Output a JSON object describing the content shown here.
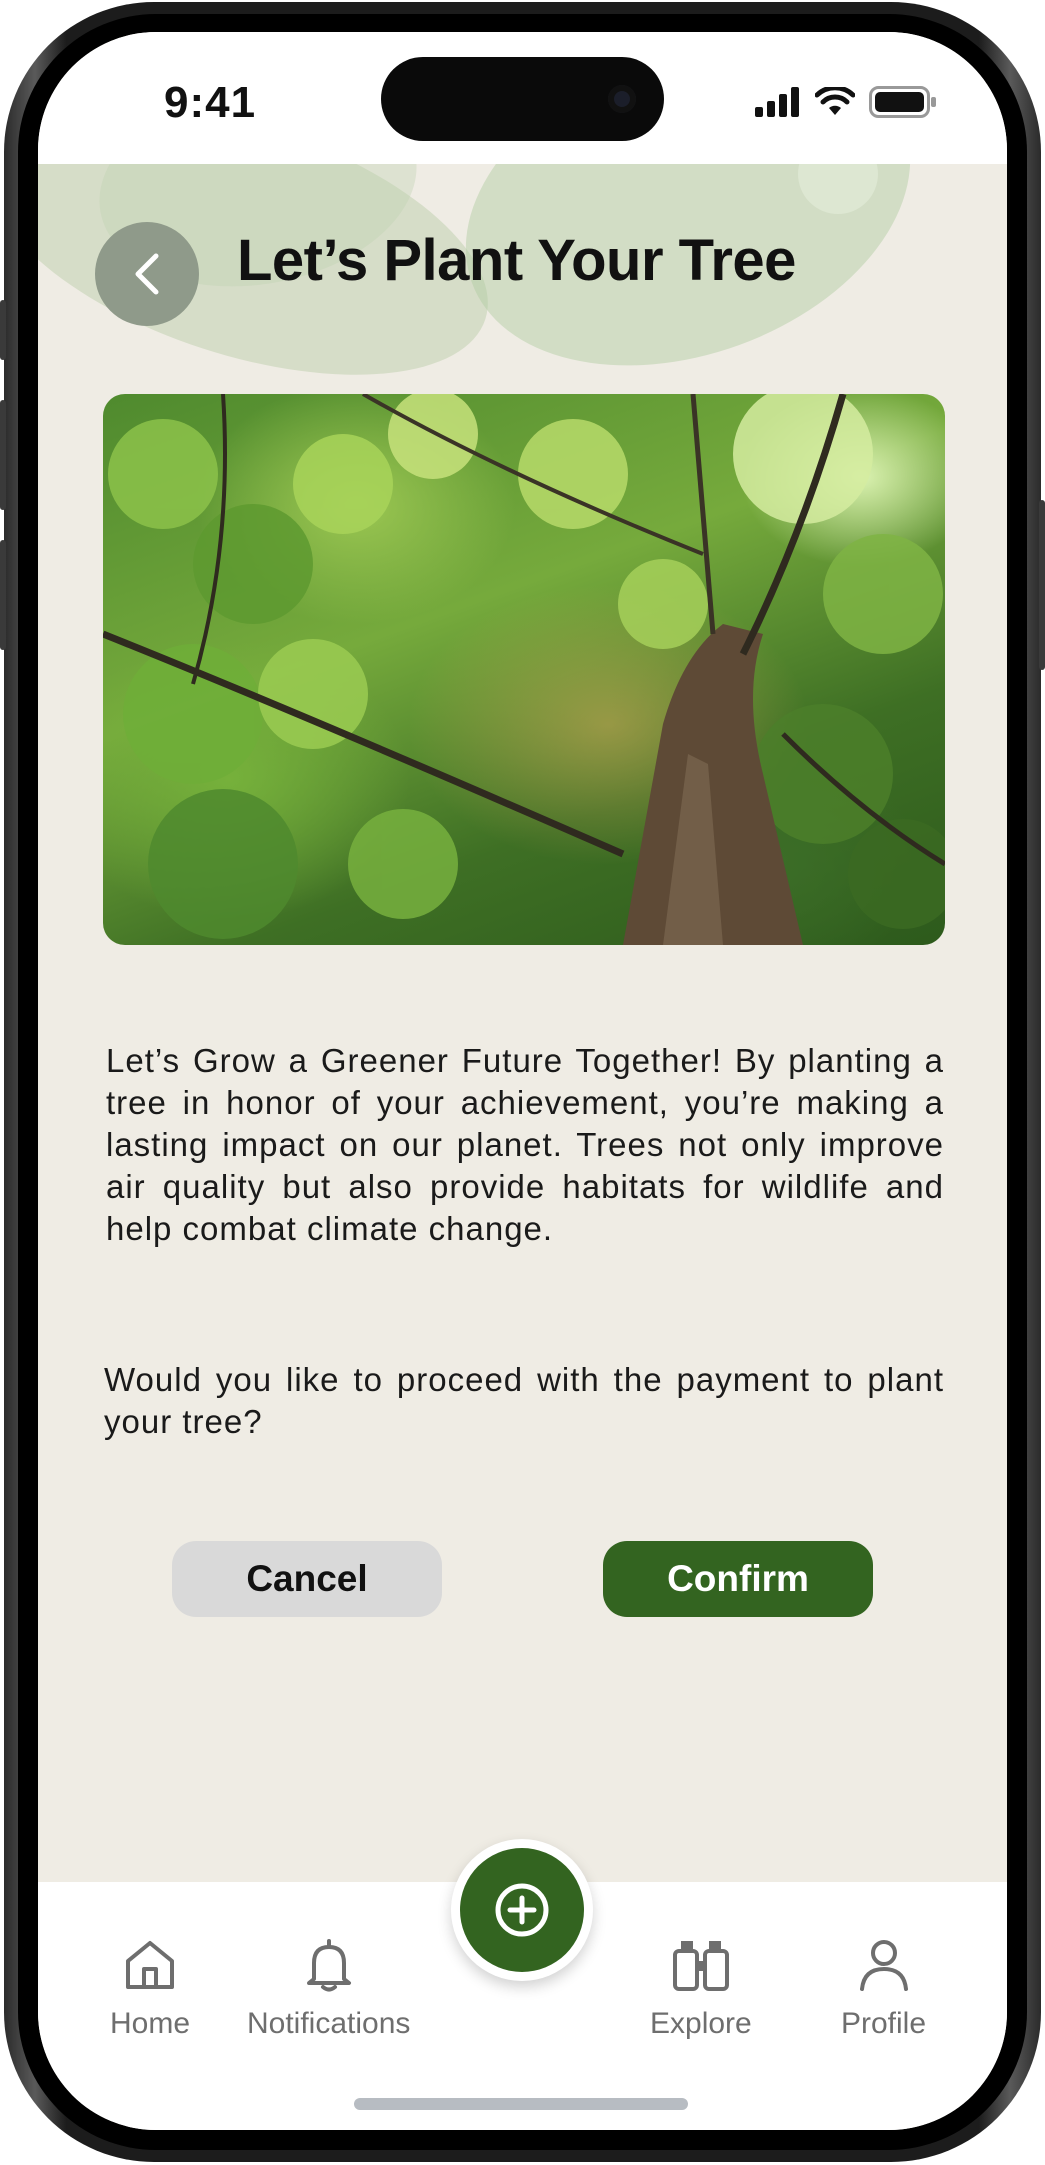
{
  "status_bar": {
    "time": "9:41",
    "icons": [
      "signal-icon",
      "wifi-icon",
      "battery-icon"
    ]
  },
  "header": {
    "title": "Let’s Plant Your Tree",
    "back_icon": "chevron-left-icon"
  },
  "hero_image": {
    "subject": "tree-canopy-photo"
  },
  "content": {
    "paragraph": "Let’s Grow a Greener Future Together! By planting a tree in honor of your achievement, you’re making a lasting impact on our planet. Trees not only improve air quality but also provide habitats for wildlife and help combat climate change.",
    "question": "Would you like to proceed with the payment to plant your tree?"
  },
  "actions": {
    "cancel_label": "Cancel",
    "confirm_label": "Confirm"
  },
  "bottom_nav": {
    "items": [
      {
        "label": "Home",
        "icon": "home-icon"
      },
      {
        "label": "Notifications",
        "icon": "bell-icon"
      },
      {
        "label": "Explore",
        "icon": "binoculars-icon"
      },
      {
        "label": "Profile",
        "icon": "user-icon"
      }
    ],
    "fab_icon": "plus-circle-icon"
  },
  "colors": {
    "primary_green": "#336420",
    "background": "#efece4",
    "cancel_gray": "#d9d9d9",
    "back_button": "#8f9a8a"
  }
}
